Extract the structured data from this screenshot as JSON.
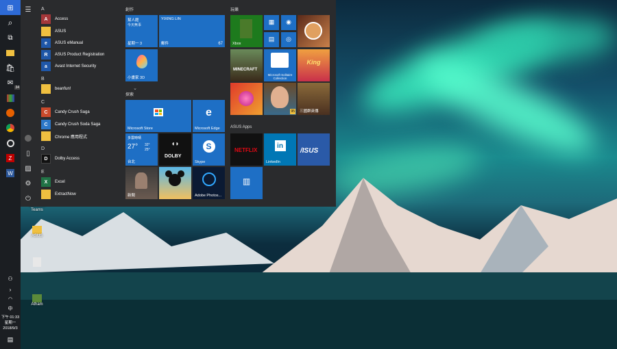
{
  "start": {
    "app_list": {
      "letters": [
        "A",
        "B",
        "C",
        "D",
        "E"
      ],
      "items": [
        {
          "label": "Access",
          "icon": "access-icon",
          "color": "#a4373a",
          "glyph": "A",
          "chevron": false
        },
        {
          "label": "ASUS",
          "icon": "folder-icon",
          "color": "#f0c040",
          "glyph": "",
          "chevron": true
        },
        {
          "label": "ASUS eManual",
          "icon": "asus-emanual-icon",
          "color": "#1f57a8",
          "glyph": "e",
          "chevron": false
        },
        {
          "label": "ASUS Product Registration",
          "icon": "asus-registration-icon",
          "color": "#1f57a8",
          "glyph": "R",
          "chevron": false
        },
        {
          "label": "Avast Internet Security",
          "icon": "avast-icon",
          "color": "#1f57a8",
          "glyph": "a",
          "chevron": false
        },
        {
          "label": "beanfun!",
          "icon": "folder-icon",
          "color": "#f0c040",
          "glyph": "",
          "chevron": true
        },
        {
          "label": "Candy Crush Saga",
          "icon": "candy-crush-icon",
          "color": "#c94a2c",
          "glyph": "C",
          "chevron": false
        },
        {
          "label": "Candy Crush Soda Saga",
          "icon": "candy-soda-icon",
          "color": "#2c78c9",
          "glyph": "C",
          "chevron": false
        },
        {
          "label": "Chrome 應用程式",
          "icon": "folder-icon",
          "color": "#f0c040",
          "glyph": "",
          "chevron": true
        },
        {
          "label": "Dolby Access",
          "icon": "dolby-icon",
          "color": "#111111",
          "glyph": "D",
          "chevron": false
        },
        {
          "label": "Excel",
          "icon": "excel-icon",
          "color": "#217346",
          "glyph": "X",
          "chevron": false
        },
        {
          "label": "ExtractNow",
          "icon": "folder-icon",
          "color": "#f0c040",
          "glyph": "",
          "chevron": true
        }
      ]
    },
    "groups": {
      "create": "創作",
      "play": "玩樂",
      "explore": "探索",
      "asus_apps": "ASUS Apps"
    },
    "tiles": {
      "calendar": {
        "line1": "幫人館",
        "line2": "今天無事",
        "day": "星期一 3"
      },
      "mail": {
        "sender": "YIXING LIN",
        "label": "郵件",
        "count": "67"
      },
      "paint3d": {
        "label": "小畫家 3D"
      },
      "xbox": {
        "label": "Xbox"
      },
      "minecraft": {
        "label": "MINECRAFT"
      },
      "solitaire": {
        "label": "Microsoft Solitaire Collection"
      },
      "store": {
        "label": "Microsoft Store"
      },
      "edge": {
        "label": "Microsoft Edge"
      },
      "weather": {
        "cond": "多雲時晴",
        "temp": "27°",
        "hi": "32°",
        "lo": "25°",
        "city": "台北"
      },
      "dolby": {
        "label": "DOLBY"
      },
      "skype": {
        "label": "Skype"
      },
      "news": {
        "label": "新聞"
      },
      "photoshop": {
        "label": "Adobe Photos..."
      },
      "netflix": {
        "label": "NETFLIX"
      },
      "linkedin": {
        "label": "LinkedIn",
        "glyph": "in"
      },
      "asus": {
        "label": "/ISUS"
      },
      "game_badge": {
        "label": "95"
      },
      "fighting": {
        "label": "三國群英傳"
      }
    },
    "rail": [
      "hamburger-icon",
      "user-icon",
      "document-icon",
      "pictures-icon",
      "settings-icon",
      "power-icon"
    ]
  },
  "desktop": {
    "icons": [
      {
        "name": "teams",
        "label": "Microsoft Teams"
      },
      {
        "name": "asus",
        "label": "ASUS"
      },
      {
        "name": "file",
        "label": ""
      },
      {
        "name": "athom",
        "label": "Atham"
      }
    ]
  },
  "taskbar": {
    "buttons": [
      "start-icon",
      "search-icon",
      "task-view-icon",
      "file-explorer-icon",
      "store-icon",
      "mail-icon",
      "winrar-icon",
      "firefox-icon",
      "chrome-icon",
      "opera-icon",
      "filezilla-icon",
      "word-icon"
    ],
    "mail_badge": "34",
    "clock": {
      "time": "下午 01:33",
      "day": "星期一",
      "date": "2018/9/3"
    },
    "ime": "中"
  }
}
